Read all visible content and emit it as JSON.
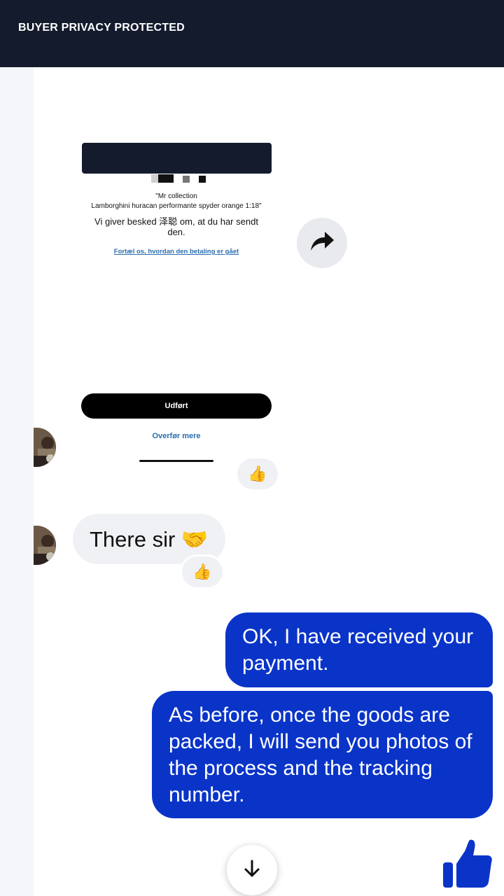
{
  "header": {
    "title": "BUYER PRIVACY PROTECTED"
  },
  "shared_screenshot": {
    "item_name": "\"Mr collection",
    "item_desc": "Lamborghini huracan performante spyder orange 1:18\"",
    "notice": "Vi giver besked 泽聪 om, at du har sendt den.",
    "feedback_link": "Fortæl os, hvordan den betaling er gået",
    "done_button": "Udført",
    "transfer_more": "Overfør mere"
  },
  "messages": {
    "incoming_1_reaction": "👍",
    "incoming_2_text": "There sir 🤝",
    "incoming_2_reaction": "👍",
    "outgoing_1_text": "OK, I have received your payment.",
    "outgoing_2_text": "As before, once the goods are packed, I will send you photos of the process and the tracking number."
  },
  "icons": {
    "share": "share-arrow-icon",
    "scroll_down": "arrow-down-icon",
    "like": "thumbs-up-icon"
  },
  "colors": {
    "header_bg": "#141b2d",
    "outgoing_bubble": "#0a34c8",
    "incoming_bubble": "#f0f1f4",
    "link_blue": "#2a6fb0"
  }
}
